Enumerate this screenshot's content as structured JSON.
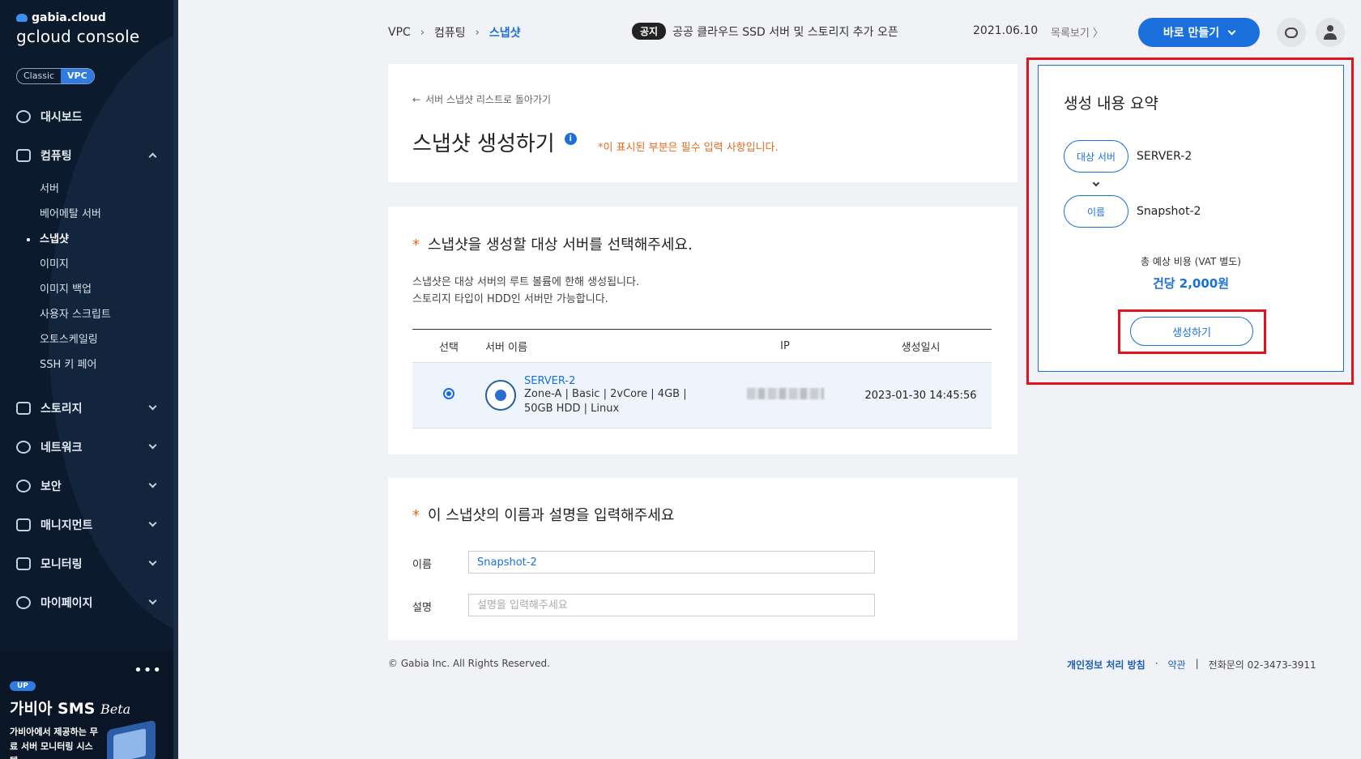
{
  "brand": {
    "small": "gabia.cloud",
    "big": "gcloud console"
  },
  "mode_toggle": {
    "classic": "Classic",
    "vpc": "VPC"
  },
  "sidebar": {
    "dashboard": "대시보드",
    "computing": {
      "label": "컴퓨팅",
      "items": [
        "서버",
        "베어메탈 서버",
        "스냅샷",
        "이미지",
        "이미지 백업",
        "사용자 스크립트",
        "오토스케일링",
        "SSH 키 페어"
      ],
      "active": "스냅샷"
    },
    "storage": "스토리지",
    "network": "네트워크",
    "security": "보안",
    "management": "매니지먼트",
    "monitoring": "모니터링",
    "mypage": "마이페이지"
  },
  "promo": {
    "badge": "UP",
    "title": "가비아 SMS",
    "title_suffix": "Beta",
    "desc": "가비아에서 제공하는 무료 서버 모니터링 시스템"
  },
  "breadcrumb": {
    "root": "VPC",
    "section": "컴퓨팅",
    "current": "스냅샷",
    "sep": "›"
  },
  "notice": {
    "tag": "공지",
    "text": "공공 클라우드 SSD 서버 및 스토리지 추가 오픈",
    "date": "2021.06.10",
    "more": "목록보기 〉"
  },
  "header": {
    "create_button": "바로 만들기"
  },
  "page": {
    "back_link": "서버 스냅샷 리스트로 돌아가기",
    "title": "스냅샷 생성하기",
    "info": "i",
    "required_note": "*이 표시된 부분은 필수 입력 사항입니다."
  },
  "select_section": {
    "star": "*",
    "title": "스냅샷을 생성할 대상 서버를 선택해주세요.",
    "desc_line1": "스냅샷은 대상 서버의 루트 볼륨에 한해 생성됩니다.",
    "desc_line2": "스토리지 타입이 HDD인 서버만 가능합니다.",
    "columns": {
      "select": "선택",
      "name": "서버 이름",
      "ip": "IP",
      "created": "생성일시"
    },
    "rows": [
      {
        "name": "SERVER-2",
        "spec_line1": "Zone-A  |  Basic  |  2vCore  |  4GB  |",
        "spec_line2": "50GB HDD  |  Linux",
        "created": "2023-01-30 14:45:56"
      }
    ]
  },
  "name_section": {
    "star": "*",
    "title": "이 스냅샷의 이름과 설명을 입력해주세요",
    "name_label": "이름",
    "name_value": "Snapshot-2",
    "desc_label": "설명",
    "desc_placeholder": "설명을 입력해주세요"
  },
  "summary": {
    "title": "생성 내용 요약",
    "target_label": "대상 서버",
    "target_value": "SERVER-2",
    "name_label": "이름",
    "name_value": "Snapshot-2",
    "cost_label": "총 예상 비용 (VAT 별도)",
    "cost_value": "건당 2,000원",
    "submit": "생성하기"
  },
  "footer": {
    "copyright": "© Gabia Inc. All Rights Reserved.",
    "privacy": "개인정보 처리 방침",
    "dot": "·",
    "terms": "약관",
    "bar": "|",
    "phone": "전화문의  02-3473-3911"
  },
  "colors": {
    "accent": "#1a6fdc",
    "sidebar": "#0c1a2e",
    "required": "#e86a1c",
    "highlight": "#e0141c"
  }
}
